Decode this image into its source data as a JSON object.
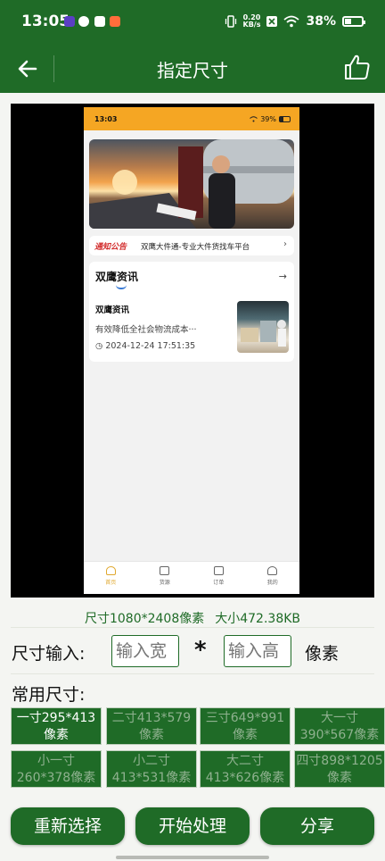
{
  "status_bar": {
    "time": "13:05",
    "network_speed_value": "0.20",
    "network_speed_unit": "KB/s",
    "battery": "38%",
    "battery_level": 0.38
  },
  "app_bar": {
    "title": "指定尺寸"
  },
  "preview": {
    "status_time": "13:03",
    "status_battery": "39%",
    "notice_tag": "通知公告",
    "notice_text": "双鹰大件通-专业大件货找车平台",
    "news_title": "双鹰资讯",
    "news_item_title": "双鹰资讯",
    "news_item_desc": "有效降低全社会物流成本···",
    "news_item_time": "2024-12-24 17:51:35",
    "tabs": [
      "首页",
      "货源",
      "订单",
      "我的"
    ]
  },
  "image_info": {
    "size": "尺寸1080*2408像素",
    "file_size": "大小472.38KB"
  },
  "size_input": {
    "label": "尺寸输入:",
    "width_placeholder": "输入宽",
    "height_placeholder": "输入高",
    "separator": "*",
    "unit": "像素"
  },
  "common_sizes": {
    "label": "常用尺寸:",
    "presets": [
      {
        "line1": "一寸295*413",
        "line2": "像素"
      },
      {
        "line1": "二寸413*579",
        "line2": "像素"
      },
      {
        "line1": "三寸649*991",
        "line2": "像素"
      },
      {
        "line1": "大一寸",
        "line2": "390*567像素"
      },
      {
        "line1": "小一寸",
        "line2": "260*378像素"
      },
      {
        "line1": "小二寸",
        "line2": "413*531像素"
      },
      {
        "line1": "大二寸",
        "line2": "413*626像素"
      },
      {
        "line1": "四寸898*1205",
        "line2": "像素"
      }
    ]
  },
  "actions": {
    "reselect": "重新选择",
    "start": "开始处理",
    "share": "分享"
  },
  "colors": {
    "primary": "#1f6b27",
    "preview_accent": "#f5a623",
    "background": "#f4f5f2"
  }
}
